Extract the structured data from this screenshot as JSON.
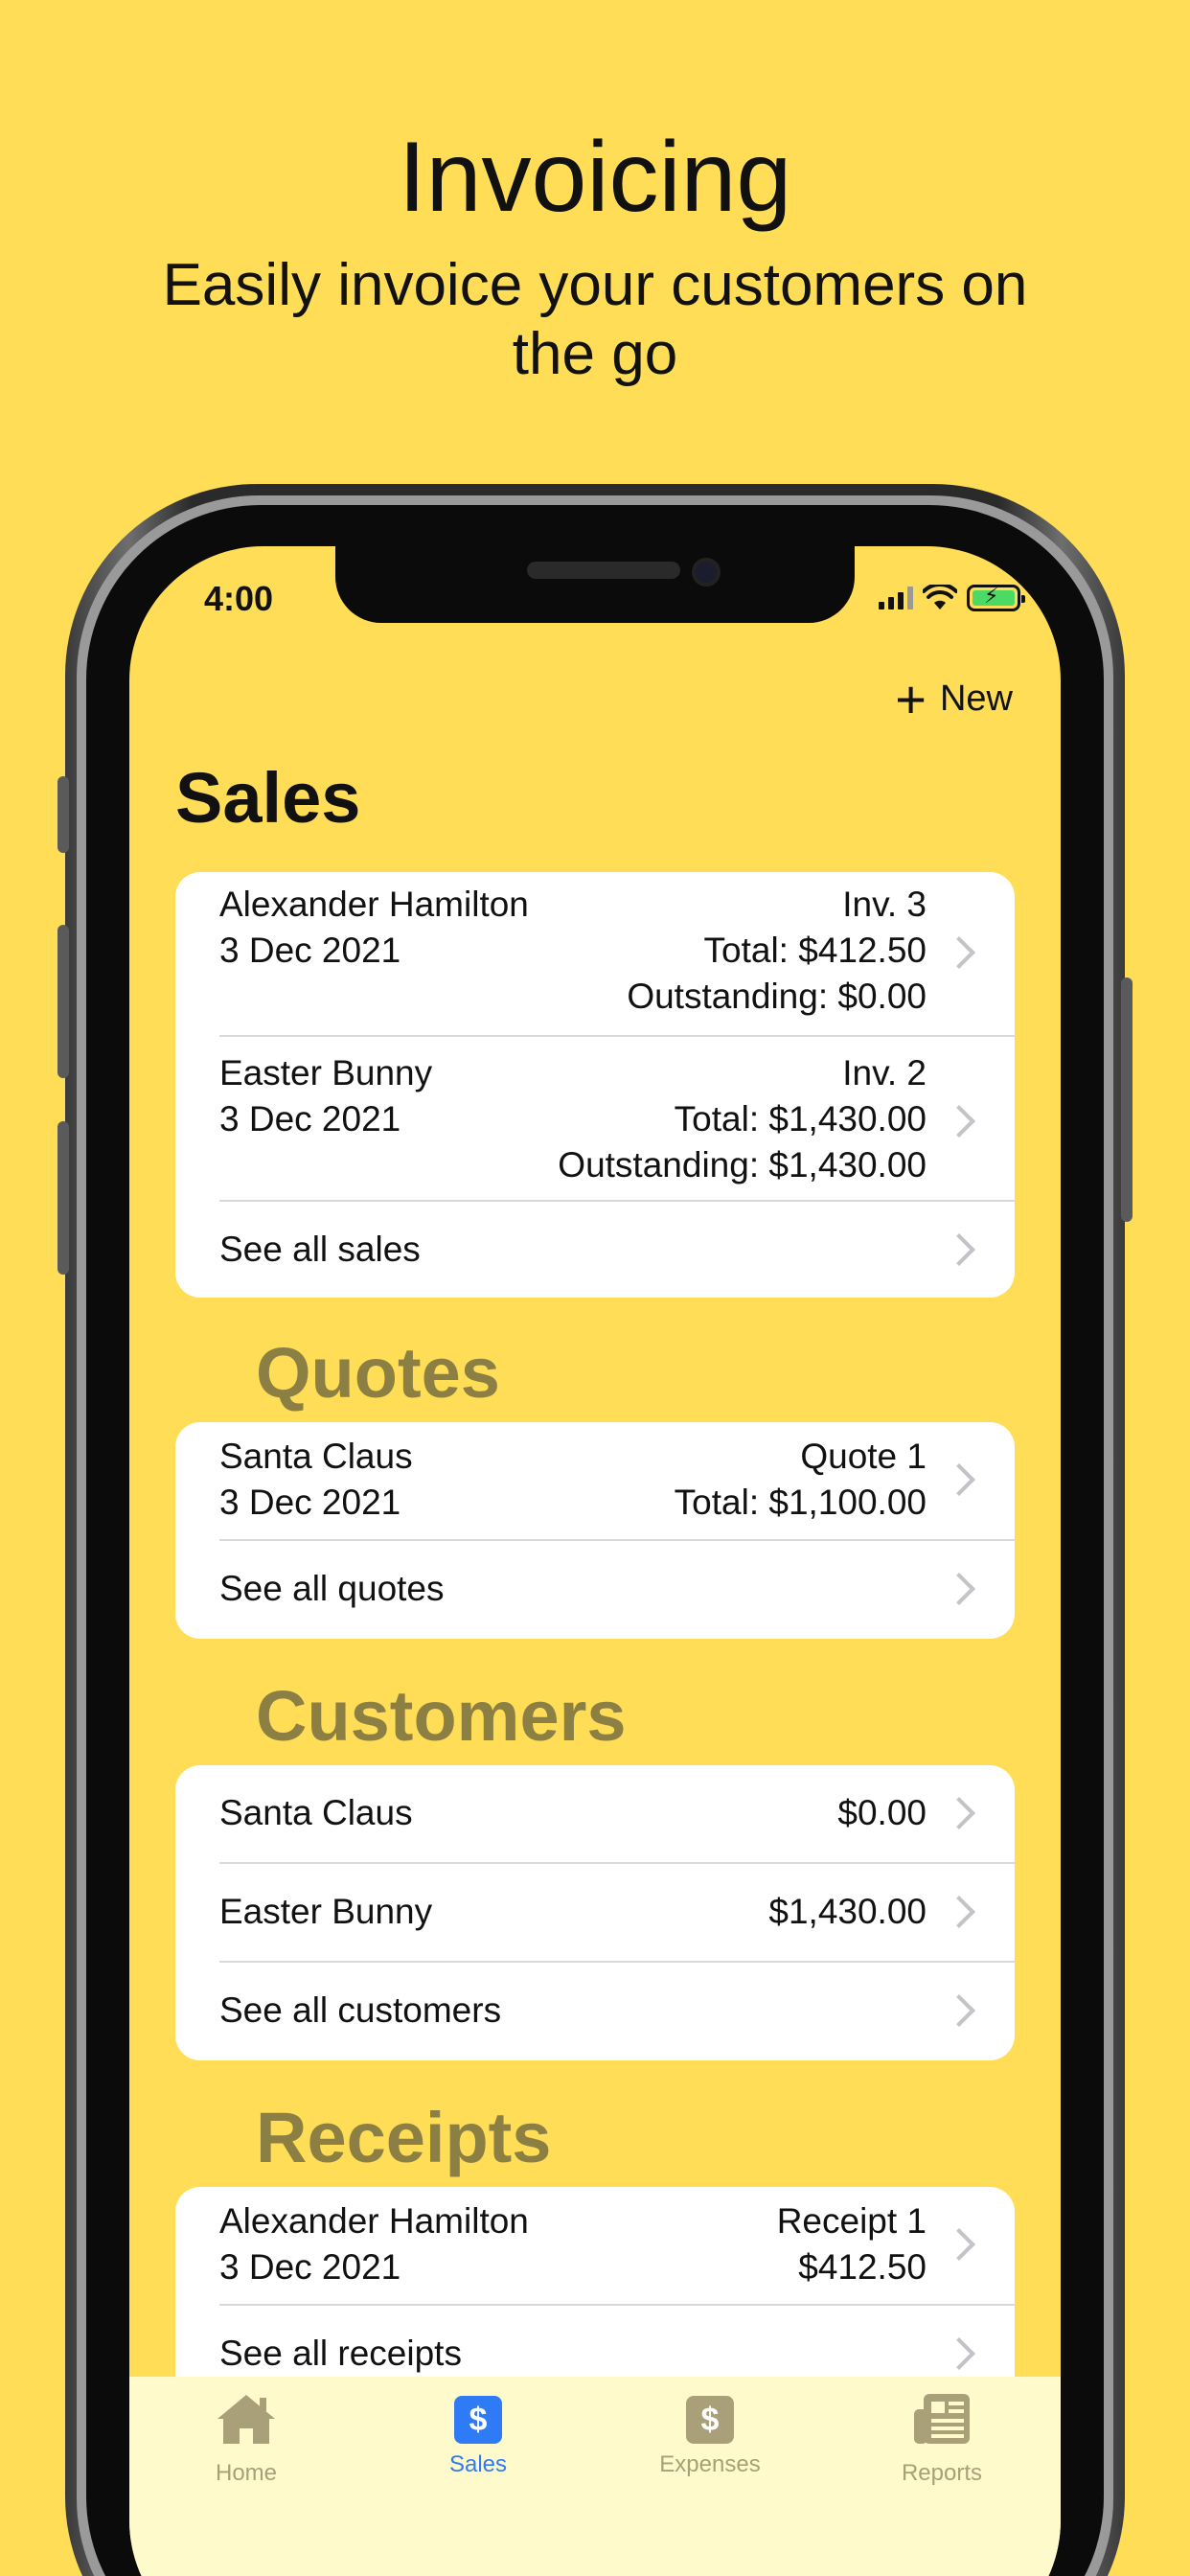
{
  "promo": {
    "title": "Invoicing",
    "subtitle": "Easily invoice your customers on the go"
  },
  "status_bar": {
    "time": "4:00"
  },
  "toolbar": {
    "new_label": "New"
  },
  "sales": {
    "title": "Sales",
    "rows": [
      {
        "customer": "Alexander Hamilton",
        "date": "3 Dec 2021",
        "number": "Inv. 3",
        "total": "Total: $412.50",
        "outstanding": "Outstanding: $0.00"
      },
      {
        "customer": "Easter Bunny",
        "date": "3 Dec 2021",
        "number": "Inv. 2",
        "total": "Total: $1,430.00",
        "outstanding": "Outstanding: $1,430.00"
      }
    ],
    "see_all": "See all sales"
  },
  "quotes": {
    "title": "Quotes",
    "rows": [
      {
        "customer": "Santa Claus",
        "date": "3 Dec 2021",
        "number": "Quote 1",
        "total": "Total: $1,100.00"
      }
    ],
    "see_all": "See all quotes"
  },
  "customers": {
    "title": "Customers",
    "rows": [
      {
        "name": "Santa Claus",
        "balance": "$0.00"
      },
      {
        "name": "Easter Bunny",
        "balance": "$1,430.00"
      }
    ],
    "see_all": "See all customers"
  },
  "receipts": {
    "title": "Receipts",
    "rows": [
      {
        "customer": "Alexander Hamilton",
        "date": "3 Dec 2021",
        "number": "Receipt 1",
        "amount": "$412.50"
      }
    ],
    "see_all": "See all receipts"
  },
  "tabs": [
    {
      "label": "Home",
      "icon": "house-icon"
    },
    {
      "label": "Sales",
      "icon": "dollar-icon",
      "selected": true
    },
    {
      "label": "Expenses",
      "icon": "dollar-icon"
    },
    {
      "label": "Reports",
      "icon": "newspaper-icon"
    }
  ],
  "colors": {
    "background": "#FFDD57",
    "section_header": "#8C7F44",
    "tab_selected": "#2F7BF5",
    "tab_inactive": "#A9A07A",
    "tabbar_bg": "#FFFACC"
  }
}
